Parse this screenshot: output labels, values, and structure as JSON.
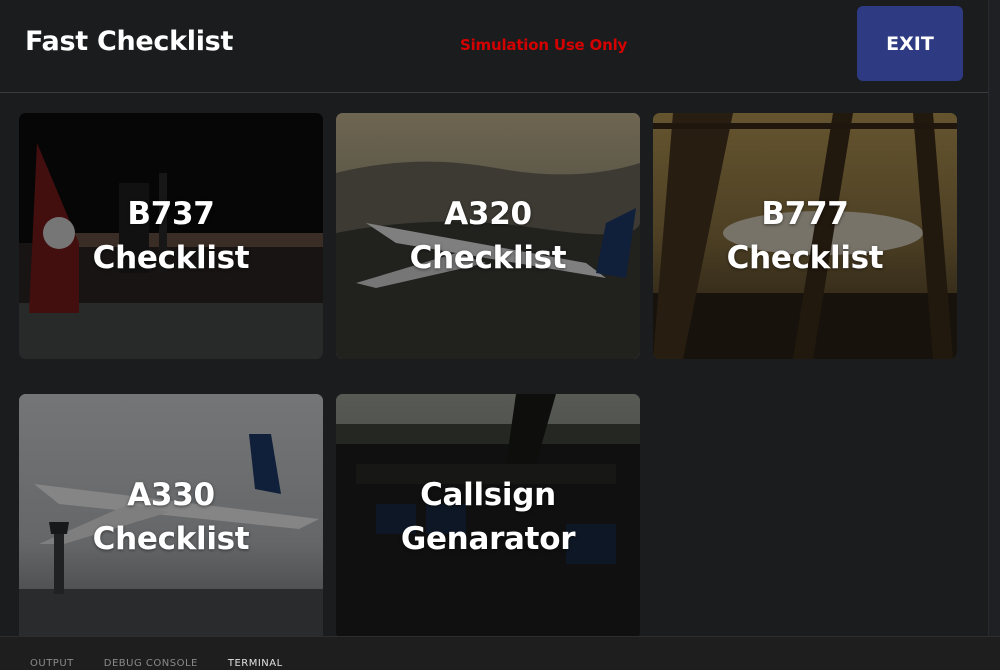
{
  "header": {
    "title": "Fast Checklist",
    "notice": "Simulation Use Only",
    "exit_label": "EXIT"
  },
  "cards": [
    {
      "id": "b737",
      "label": "B737\nChecklist"
    },
    {
      "id": "a320",
      "label": "A320\nChecklist"
    },
    {
      "id": "b777",
      "label": "B777\nChecklist"
    },
    {
      "id": "a330",
      "label": "A330\nChecklist"
    },
    {
      "id": "callsign",
      "label": "Callsign\nGenarator"
    }
  ],
  "panel_tabs": [
    "OUTPUT",
    "DEBUG CONSOLE",
    "TERMINAL"
  ],
  "colors": {
    "background": "#1b1c1e",
    "exit_button": "#2e3b82",
    "notice_text": "#d40000"
  }
}
